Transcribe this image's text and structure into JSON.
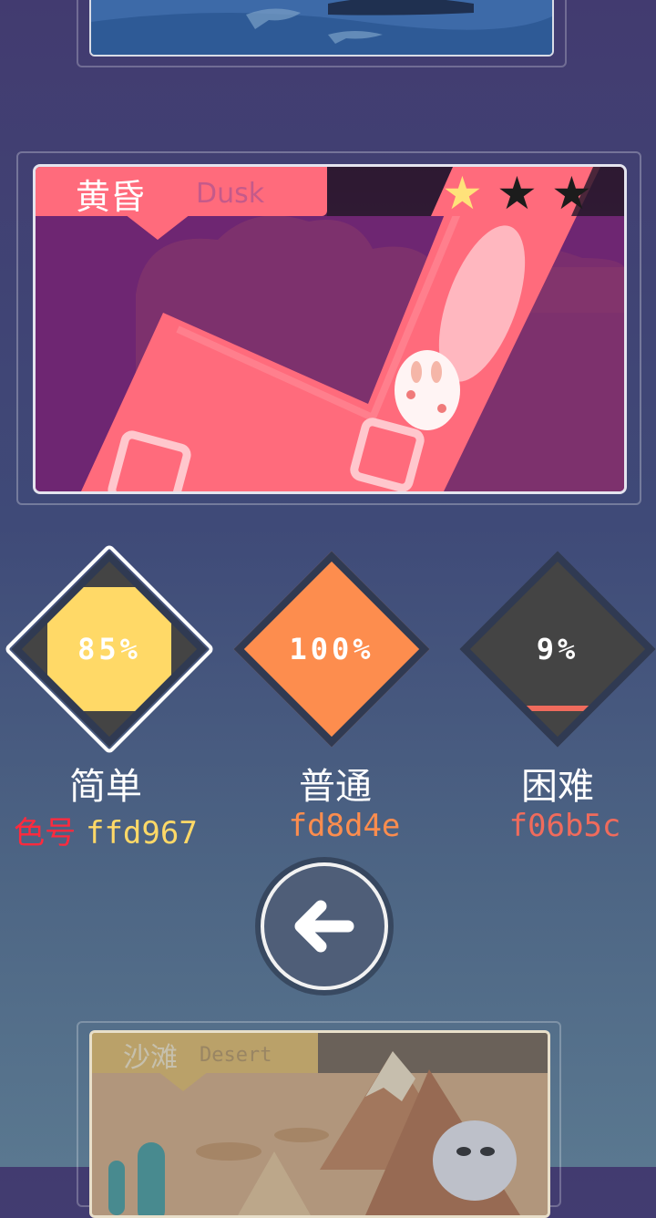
{
  "levels": {
    "current": {
      "title_cn": "黄昏",
      "title_en": "Dusk",
      "stars_earned": 1,
      "stars_total": 3
    },
    "next": {
      "title_cn": "沙滩",
      "title_en": "Desert"
    }
  },
  "difficulties": [
    {
      "name": "简单",
      "percent": "85%",
      "progress": 0.85,
      "color": "#ffd967",
      "color_prefix": "色号 ",
      "color_code": "ffd967"
    },
    {
      "name": "普通",
      "percent": "100%",
      "progress": 1.0,
      "color": "#fd8d4e",
      "color_code": "fd8d4e"
    },
    {
      "name": "困难",
      "percent": "9%",
      "progress": 0.09,
      "color": "#f06b5c",
      "color_code": "f06b5c"
    }
  ],
  "colors": {
    "accent_pink": "#ff6b7c",
    "prefix_red": "#ff2a3d",
    "star_filled": "#ffe27a",
    "star_empty": "#1c1c1c"
  },
  "icons": {
    "back": "arrow-left-icon",
    "star": "star-icon"
  }
}
